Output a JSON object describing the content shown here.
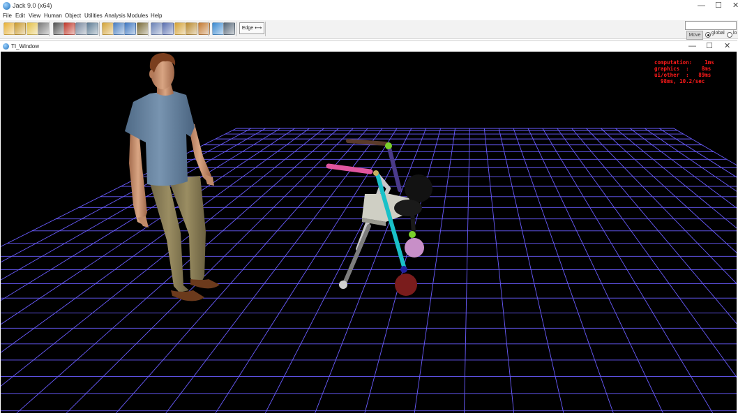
{
  "app": {
    "title": "Jack 9.0   (x64)",
    "controls": {
      "minimize": "—",
      "maximize": "☐",
      "close": "✕"
    }
  },
  "menu": [
    "File",
    "Edit",
    "View",
    "Human",
    "Object",
    "Utilities",
    "Analysis",
    "Modules",
    "Help"
  ],
  "toolbar": {
    "edge_label": "Edge ⟷",
    "move_label": "Move",
    "radio_global": "global",
    "radio_local": "lo",
    "icon_colors": [
      "#e7b23a",
      "#c99a2e",
      "#e3c14a",
      "#7a7a7a",
      "#555555",
      "#c0392b",
      "#7a8aa0",
      "#5f7d95",
      "#d4a53a",
      "#4a7fc1",
      "#3f77c0",
      "#7a6c3a",
      "#6b82b6",
      "#5a6fb0",
      "#d4a236",
      "#b98a2f",
      "#c47b33",
      "#3b8ad1",
      "#556677"
    ]
  },
  "inner_window": {
    "title": "TI_Window",
    "controls": {
      "minimize": "—",
      "maximize": "☐",
      "close": "✕"
    }
  },
  "stats": {
    "line1": "computation:    1ms",
    "line2": "graphics  :    8ms",
    "line3": "ui/other  :   89ms",
    "line4": "  98ms, 10.2/sec"
  },
  "colors": {
    "grid": "#6a5cff",
    "background": "#000000",
    "stats_text": "#ff1a1a"
  }
}
